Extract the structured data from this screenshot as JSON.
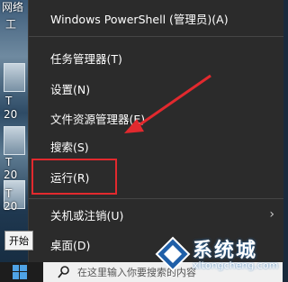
{
  "desktop": {
    "labels": [
      "网络",
      "工",
      "T",
      "20",
      "T",
      "20",
      "T",
      "20"
    ]
  },
  "menu": {
    "items": [
      {
        "label": "Windows PowerShell (管理员)(A)"
      },
      {
        "label": "任务管理器(T)"
      },
      {
        "label": "设置(N)"
      },
      {
        "label": "文件资源管理器(E)"
      },
      {
        "label": "搜索(S)"
      },
      {
        "label": "运行(R)"
      },
      {
        "label": "关机或注销(U)"
      },
      {
        "label": "桌面(D)"
      }
    ],
    "highlight_color": "#e2292e",
    "arrow_color": "#e2292e"
  },
  "taskbar": {
    "start_tooltip": "开始",
    "search_placeholder": "在这里输入你要搜索的内容"
  },
  "watermark": {
    "title": "系统城",
    "url": "xitongcheng.com"
  }
}
